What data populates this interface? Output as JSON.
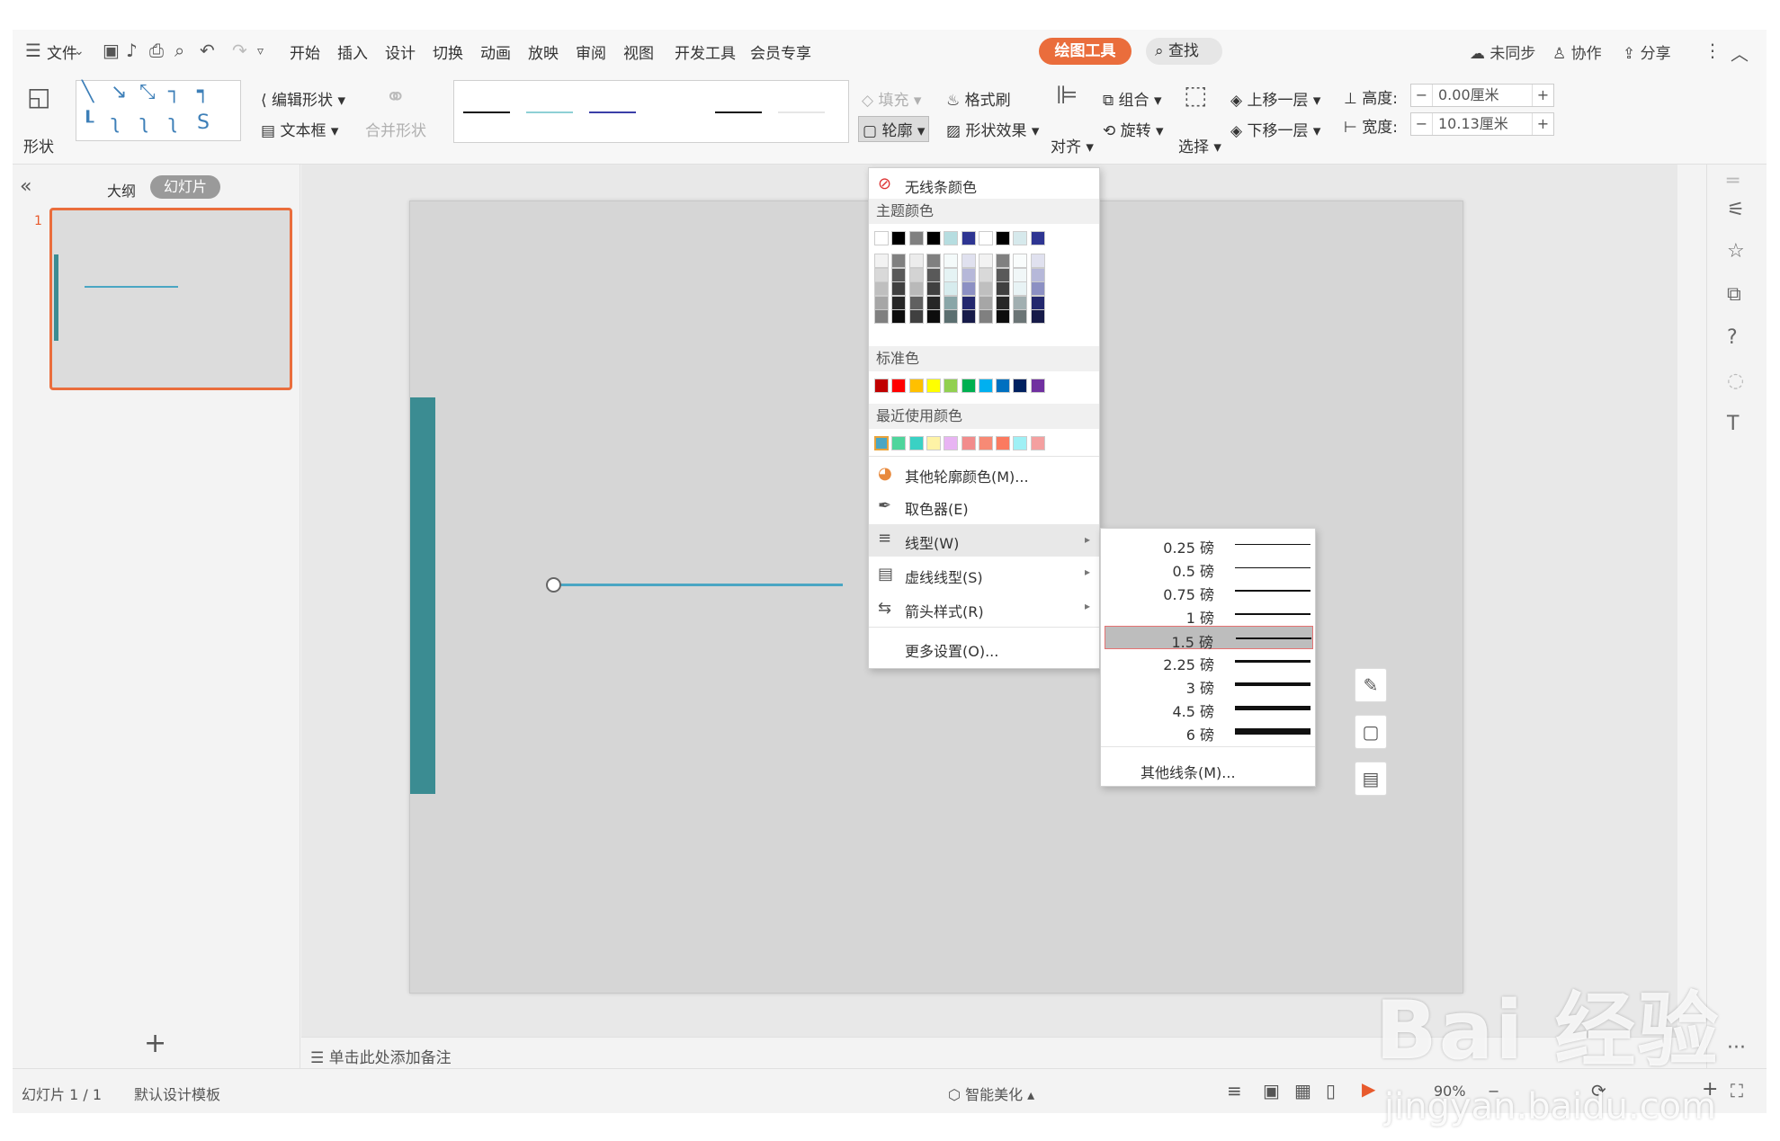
{
  "menubar": {
    "file_label": "文件",
    "tabs": [
      "开始",
      "插入",
      "设计",
      "切换",
      "动画",
      "放映",
      "审阅",
      "视图",
      "开发工具",
      "会员专享"
    ],
    "active_tab": "绘图工具",
    "search_label": "查找",
    "sync_label": "未同步",
    "collab_label": "协作",
    "share_label": "分享"
  },
  "ribbon": {
    "shape_label": "形状",
    "edit_shape_label": "编辑形状",
    "textbox_label": "文本框",
    "merge_shape_label": "合并形状",
    "fill_label": "填充",
    "format_painter_label": "格式刷",
    "outline_label": "轮廓",
    "shape_effect_label": "形状效果",
    "align_label": "对齐",
    "group_label": "组合",
    "rotate_label": "旋转",
    "select_label": "选择",
    "bring_forward_label": "上移一层",
    "send_backward_label": "下移一层",
    "height_label": "高度:",
    "height_value": "0.00厘米",
    "width_label": "宽度:",
    "width_value": "10.13厘米"
  },
  "leftpanel": {
    "outline_tab": "大纲",
    "slides_tab": "幻灯片",
    "slide_number": "1"
  },
  "notes": {
    "placeholder": "单击此处添加备注"
  },
  "statusbar": {
    "slide_info": "幻灯片 1 / 1",
    "template": "默认设计模板",
    "beautify_label": "智能美化",
    "zoom": "90%"
  },
  "outline_menu": {
    "no_line_label": "无线条颜色",
    "theme_colors_label": "主题颜色",
    "theme_row": [
      "#ffffff",
      "#000000",
      "#808080",
      "#000000",
      "#b6dde0",
      "#2e3592",
      "#ffffff",
      "#000000",
      "#d6e9ec",
      "#2e3592"
    ],
    "standard_colors_label": "标准色",
    "standard_colors": [
      "#c00000",
      "#ff0000",
      "#ffc000",
      "#ffff00",
      "#92d050",
      "#00b050",
      "#00b0f0",
      "#0070c0",
      "#002060",
      "#7030a0"
    ],
    "recent_colors_label": "最近使用颜色",
    "recent_colors": [
      "#4aa6c3",
      "#4fd59c",
      "#3ad1c4",
      "#fef3a6",
      "#e8b4f3",
      "#f28c8c",
      "#f78a75",
      "#fb7a5f",
      "#9ff0f5",
      "#f4a0a0"
    ],
    "more_colors_label": "其他轮廓颜色(M)...",
    "eyedropper_label": "取色器(E)",
    "line_style_label": "线型(W)",
    "dash_style_label": "虚线线型(S)",
    "arrow_style_label": "箭头样式(R)",
    "more_settings_label": "更多设置(O)..."
  },
  "weight_menu": {
    "items": [
      "0.25 磅",
      "0.5 磅",
      "0.75 磅",
      "1 磅",
      "1.5 磅",
      "2.25 磅",
      "3 磅",
      "4.5 磅",
      "6 磅"
    ],
    "selected": "1.5 磅",
    "more_label": "其他线条(M)..."
  },
  "watermark": {
    "brand": "Bai 经验",
    "url": "jingyan.baidu.com"
  }
}
